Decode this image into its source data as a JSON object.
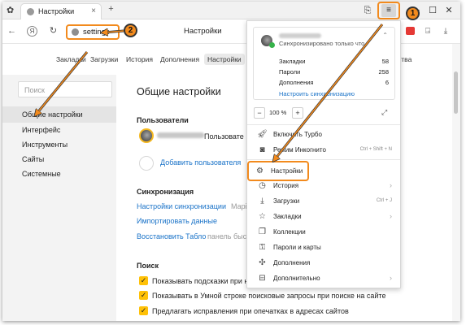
{
  "titlebar": {
    "tab_title": "Настройки",
    "tab_close": "×",
    "new_tab": "+"
  },
  "toolbar": {
    "back": "←",
    "yandex_button": "Я",
    "reload": "↻",
    "address_text": "settings",
    "page_title": "Настройки"
  },
  "settings_nav": {
    "items": [
      "Закладки",
      "Загрузки",
      "История",
      "Дополнения",
      "Настройки"
    ],
    "active": "Настройки",
    "trailing_fragment": "ства"
  },
  "sidebar": {
    "search_placeholder": "Поиск",
    "items": [
      "Общие настройки",
      "Интерфейс",
      "Инструменты",
      "Сайты",
      "Системные"
    ],
    "active": "Общие настройки"
  },
  "main": {
    "title": "Общие настройки",
    "users_section": "Пользователи",
    "user_suffix": "Пользовате",
    "add_user": "Добавить пользователя",
    "sync_section": "Синхронизация",
    "sync_settings_link": "Настройки синхронизации",
    "sync_settings_fragment": "Марі",
    "import_link": "Импортировать данные",
    "restore_tablo_link": "Восстановить Табло",
    "restore_tablo_fragment": "панель быс",
    "search_section": "Поиск",
    "checkboxes": [
      "Показывать подсказки при на",
      "Показывать в Умной строке поисковые запросы при поиске на сайте",
      "Предлагать исправления при опечатках в адресах сайтов"
    ]
  },
  "menu": {
    "sync_status": "Синхронизировано только что",
    "sync_rows": [
      {
        "label": "Закладки",
        "value": "58"
      },
      {
        "label": "Пароли",
        "value": "258"
      },
      {
        "label": "Дополнения",
        "value": "6"
      }
    ],
    "sync_settings_link": "Настроить синхронизацию",
    "zoom_minus": "−",
    "zoom_value": "100 %",
    "zoom_plus": "+",
    "items": [
      {
        "label": "Включить Турбо",
        "shortcut": "",
        "chevron": false
      },
      {
        "label": "Режим Инкогнито",
        "shortcut": "Ctrl + Shift + N",
        "chevron": false
      },
      {
        "label": "Настройки",
        "shortcut": "",
        "chevron": false
      },
      {
        "label": "История",
        "shortcut": "",
        "chevron": true
      },
      {
        "label": "Загрузки",
        "shortcut": "Ctrl + J",
        "chevron": false
      },
      {
        "label": "Закладки",
        "shortcut": "",
        "chevron": true
      },
      {
        "label": "Коллекции",
        "shortcut": "",
        "chevron": false
      },
      {
        "label": "Пароли и карты",
        "shortcut": "",
        "chevron": false
      },
      {
        "label": "Дополнения",
        "shortcut": "",
        "chevron": false
      },
      {
        "label": "Дополнительно",
        "shortcut": "",
        "chevron": true
      }
    ]
  },
  "annotations": {
    "badge_1": "1",
    "badge_2": "2",
    "accent_color": "#f28a1d"
  },
  "colors": {
    "link": "#1a73c8",
    "checkbox": "#ffc107",
    "sidebar_bg": "#f3f3f3"
  }
}
